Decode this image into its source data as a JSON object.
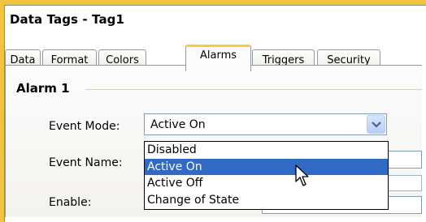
{
  "window": {
    "title": "Data Tags - Tag1"
  },
  "tabs": [
    {
      "label": "Data",
      "active": false
    },
    {
      "label": "Format",
      "active": false
    },
    {
      "label": "Colors",
      "active": false
    },
    {
      "label": "Alarms",
      "active": true
    },
    {
      "label": "Triggers",
      "active": false
    },
    {
      "label": "Security",
      "active": false
    }
  ],
  "alarm_group": {
    "title": "Alarm 1",
    "event_mode": {
      "label": "Event Mode:",
      "value": "Active On",
      "options": [
        "Disabled",
        "Active On",
        "Active Off",
        "Change of State"
      ],
      "highlighted": "Active On"
    },
    "event_name": {
      "label": "Event Name:",
      "value": ""
    },
    "enable": {
      "label": "Enable:",
      "value": ""
    }
  },
  "icons": {
    "combo_arrow": "chevron-down-icon",
    "pointer": "mouse-pointer-icon"
  },
  "colors": {
    "frame": "#f2c33c",
    "active_tab_accent": "#ffc73c",
    "selection": "#316ac5"
  }
}
